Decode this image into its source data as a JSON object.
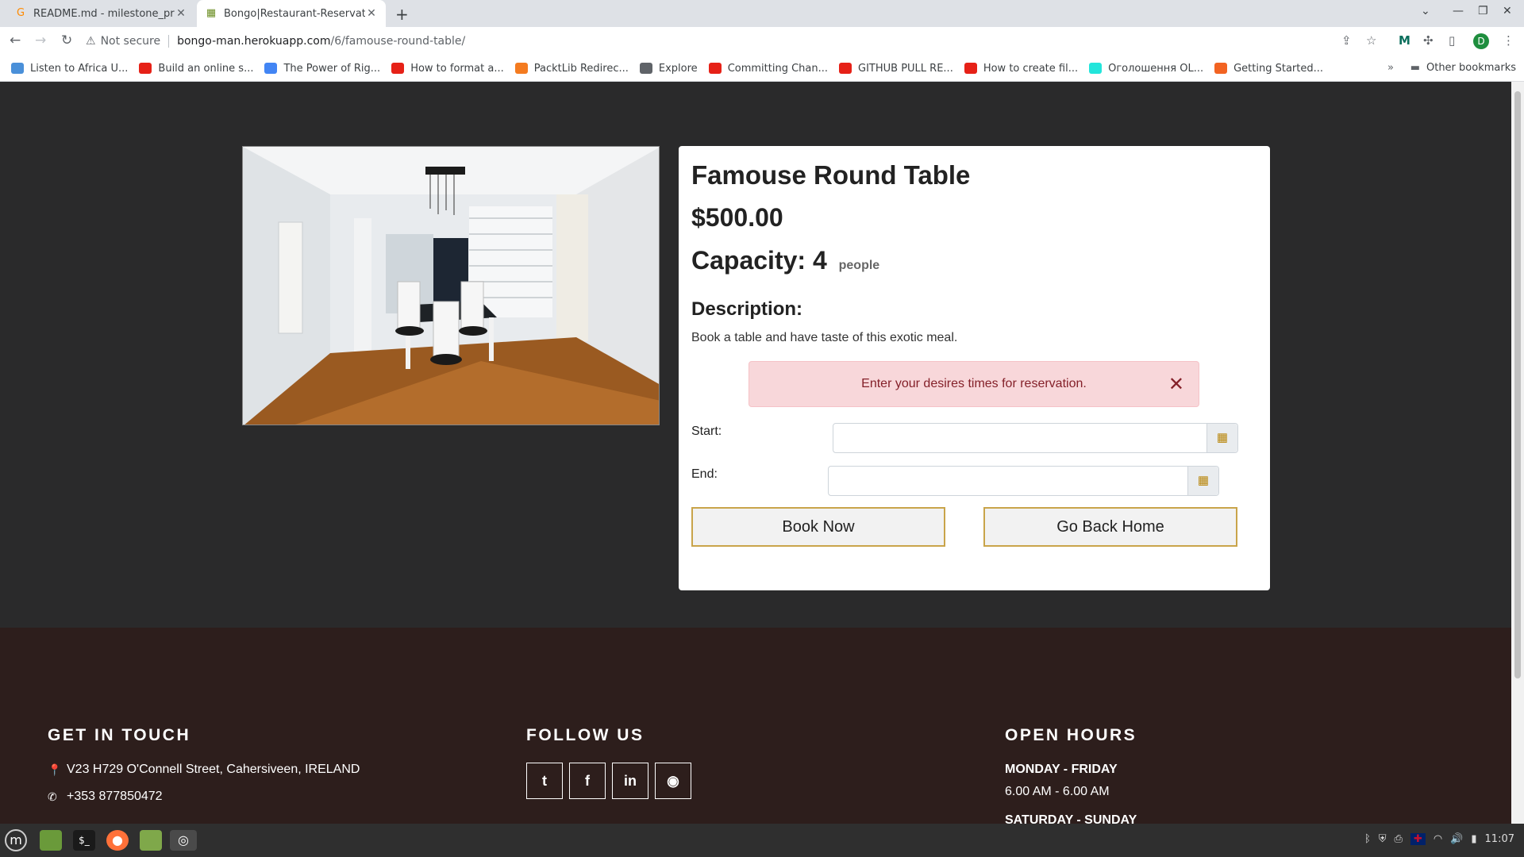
{
  "browser": {
    "tabs": [
      {
        "title": "README.md - milestone_proj",
        "active": false
      },
      {
        "title": "Bongo|Restaurant-Reservatio",
        "active": true
      }
    ],
    "new_tab": "+",
    "address": {
      "security_label": "Not secure",
      "host": "bongo-man.herokuapp.com",
      "path": "/6/famouse-round-table/"
    },
    "profile_initial": "D",
    "bookmarks": [
      {
        "label": "Listen to Africa U...",
        "icon": "m-icon",
        "color": "#4a90d9"
      },
      {
        "label": "Build an online s...",
        "icon": "youtube-icon",
        "color": "#e62117"
      },
      {
        "label": "The Power of Rig...",
        "icon": "google-icon",
        "color": "#4285f4"
      },
      {
        "label": "How to format a...",
        "icon": "youtube-icon",
        "color": "#e62117"
      },
      {
        "label": "PacktLib Redirec...",
        "icon": "packt-icon",
        "color": "#f47b20"
      },
      {
        "label": "Explore",
        "icon": "globe-icon",
        "color": "#5f6368"
      },
      {
        "label": "Committing Chan...",
        "icon": "youtube-icon",
        "color": "#e62117"
      },
      {
        "label": "GITHUB PULL RE...",
        "icon": "youtube-icon",
        "color": "#e62117"
      },
      {
        "label": "How to create fil...",
        "icon": "youtube-icon",
        "color": "#e62117"
      },
      {
        "label": "Оголошення OL...",
        "icon": "olx-icon",
        "color": "#23e5db"
      },
      {
        "label": "Getting Started...",
        "icon": "getting-started-icon",
        "color": "#f26322"
      }
    ],
    "more_bookmarks": "»",
    "other_bookmarks": "Other bookmarks"
  },
  "table": {
    "name": "Famouse Round Table",
    "price": "$500.00",
    "capacity_label": "Capacity: 4",
    "capacity_unit": "people",
    "description_heading": "Description:",
    "description": "Book a table and have taste of this exotic meal."
  },
  "alert": {
    "message": "Enter your desires times for reservation."
  },
  "form": {
    "start_label": "Start:",
    "start_value": "",
    "end_label": "End:",
    "end_value": "",
    "book_button": "Book Now",
    "home_button": "Go Back Home"
  },
  "footer": {
    "contact_heading": "GET IN TOUCH",
    "address": "V23 H729 O'Connell Street, Cahersiveen, IRELAND",
    "phone": "+353 877850472",
    "follow_heading": "FOLLOW US",
    "social": [
      "twitter-icon",
      "facebook-icon",
      "linkedin-icon",
      "github-icon"
    ],
    "hours_heading": "OPEN HOURS",
    "weekday_label": "MONDAY - FRIDAY",
    "weekday_hours": "6.00 AM - 6.00 AM",
    "weekend_label": "SATURDAY - SUNDAY"
  },
  "taskbar": {
    "clock": "11:07"
  },
  "colors": {
    "page_bg": "#2a2a2b",
    "footer_bg": "#2d1e1c",
    "alert_bg": "#f8d7da",
    "button_border": "#c9a44a"
  }
}
